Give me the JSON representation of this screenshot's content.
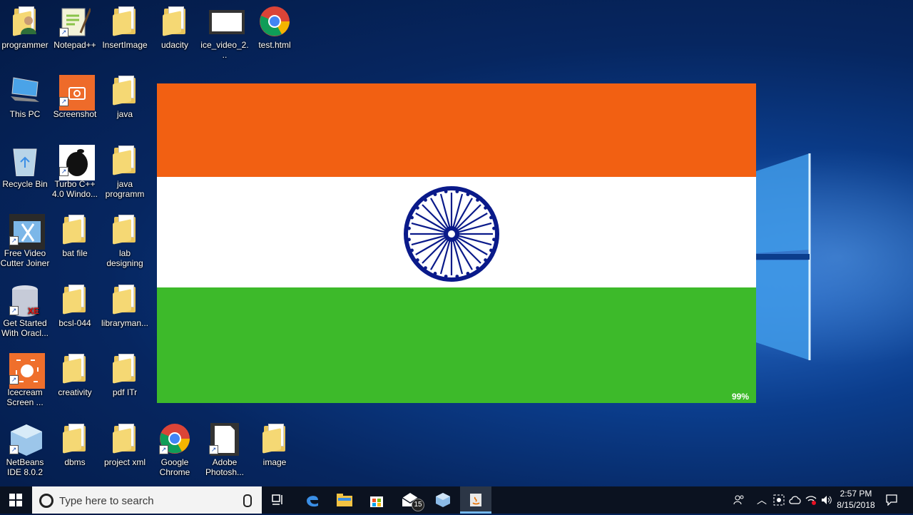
{
  "desktop": {
    "icons": [
      {
        "label": "programmer",
        "icon": "user-folder-icon"
      },
      {
        "label": "Notepad++",
        "icon": "notepad-plus-plus-icon"
      },
      {
        "label": "InsertImage",
        "icon": "folder-icon"
      },
      {
        "label": "udacity",
        "icon": "folder-icon"
      },
      {
        "label": "ice_video_2...",
        "icon": "video-file-icon"
      },
      {
        "label": "test.html",
        "icon": "chrome-icon"
      },
      {
        "label": "This PC",
        "icon": "this-pc-icon"
      },
      {
        "label": "Screenshot",
        "icon": "screenshot-app-icon"
      },
      {
        "label": "java",
        "icon": "folder-icon"
      },
      {
        "label": "Recycle Bin",
        "icon": "recycle-bin-icon"
      },
      {
        "label": "Turbo C++ 4.0 Windo...",
        "icon": "turbo-cpp-icon"
      },
      {
        "label": "java programm",
        "icon": "folder-icon"
      },
      {
        "label": "Free Video Cutter Joiner",
        "icon": "video-cutter-icon"
      },
      {
        "label": "bat file",
        "icon": "folder-icon"
      },
      {
        "label": "lab designing",
        "icon": "folder-icon"
      },
      {
        "label": "Get Started With Oracl...",
        "icon": "oracle-db-icon"
      },
      {
        "label": "bcsl-044",
        "icon": "folder-icon"
      },
      {
        "label": "libraryman...",
        "icon": "folder-icon"
      },
      {
        "label": "Icecream Screen ...",
        "icon": "icecream-recorder-icon"
      },
      {
        "label": "creativity",
        "icon": "folder-icon"
      },
      {
        "label": "pdf ITr",
        "icon": "folder-icon"
      },
      {
        "label": "NetBeans IDE 8.0.2",
        "icon": "netbeans-icon"
      },
      {
        "label": "dbms",
        "icon": "folder-icon"
      },
      {
        "label": "project xml",
        "icon": "folder-icon"
      },
      {
        "label": "Google Chrome",
        "icon": "chrome-icon"
      },
      {
        "label": "Adobe Photosh...",
        "icon": "document-icon"
      },
      {
        "label": "image",
        "icon": "folder-icon"
      }
    ]
  },
  "flag_window": {
    "progress": "99%",
    "colors": {
      "saffron": "#f26012",
      "white": "#ffffff",
      "green": "#3dba2a",
      "chakra": "#0a1a8a"
    }
  },
  "taskbar": {
    "search_placeholder": "Type here to search",
    "mail_badge": "15",
    "time": "2:57 PM",
    "date": "8/15/2018",
    "pinned": [
      "task-view-icon",
      "edge-icon",
      "file-explorer-icon",
      "store-icon",
      "mail-icon",
      "virtualbox-icon",
      "java-icon"
    ]
  }
}
